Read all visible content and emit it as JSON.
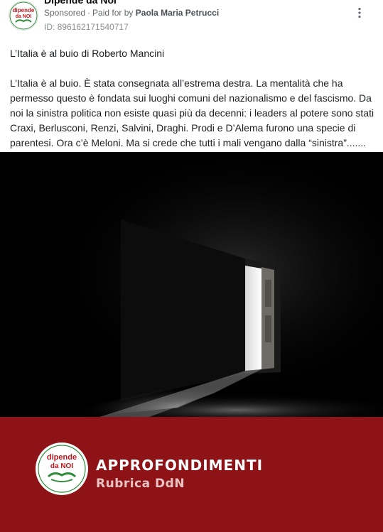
{
  "header": {
    "page_name": "Dipende da Noi",
    "sponsored_label": "Sponsored",
    "separator": "·",
    "paid_for_label": "Paid for by",
    "payer_name": "Paola Maria Petrucci",
    "ad_id": "ID: 896162171540717",
    "avatar_text_top": "dipende",
    "avatar_text_bottom": "da NOI"
  },
  "post": {
    "title": "L’Italia è al buio di Roberto Mancini",
    "body_lines": [
      "L’Italia è al buio. È stata consegnata all’estrema destra. La mentalità che ha",
      "permesso questo è fondata sui luoghi comuni del nazionalismo e del fascismo. Da",
      "noi la sinistra politica non esiste quasi più da decenni: i leaders al potere sono stati",
      "Craxi, Berlusconi, Renzi, Salvini, Draghi. Prodi e D’Alema furono una specie di",
      "parentesi. Ora c’è Meloni. Ma si crede che tutti i mali vengano dalla “sinistra”......."
    ]
  },
  "banner": {
    "title": "APPROFONDIMENTI",
    "subtitle": "Rubrica DdN",
    "logo_text_top": "dipende",
    "logo_text_bottom": "da NOI"
  },
  "icons": {
    "more": "more-options-icon",
    "handshake": "handshake-icon"
  },
  "colors": {
    "banner_red": "#8e1316",
    "logo_red": "#c0161b",
    "logo_green": "#2f8c3a"
  }
}
